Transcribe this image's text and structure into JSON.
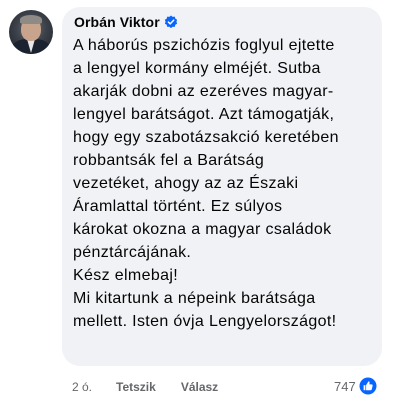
{
  "comment": {
    "author": "Orbán Viktor",
    "verified_icon": "verified-badge-icon",
    "body_lines": [
      "A háborús pszichózis foglyul ejtette",
      "a lengyel kormány elméjét. Sutba",
      "akarják dobni az ezeréves magyar-",
      "lengyel barátságot. Azt támogatják,",
      "hogy egy szabotázsakció keretében",
      "robbantsák fel a Barátság",
      "vezetéket, ahogy az az Északi",
      "Áramlattal történt. Ez súlyos",
      "károkat okozna a magyar családok",
      "pénztárcájának.",
      "Kész elmebaj!",
      "Mi kitartunk a népeink barátsága",
      "mellett. Isten óvja Lengyelországot!"
    ]
  },
  "actions": {
    "time": "2 ó.",
    "like_label": "Tetszik",
    "reply_label": "Válasz"
  },
  "reactions": {
    "count": "747",
    "icon": "like-reaction-icon"
  },
  "colors": {
    "bubble": "#f0f2f5",
    "text": "#050505",
    "secondary": "#65676b",
    "accent_blue": "#0866ff"
  }
}
